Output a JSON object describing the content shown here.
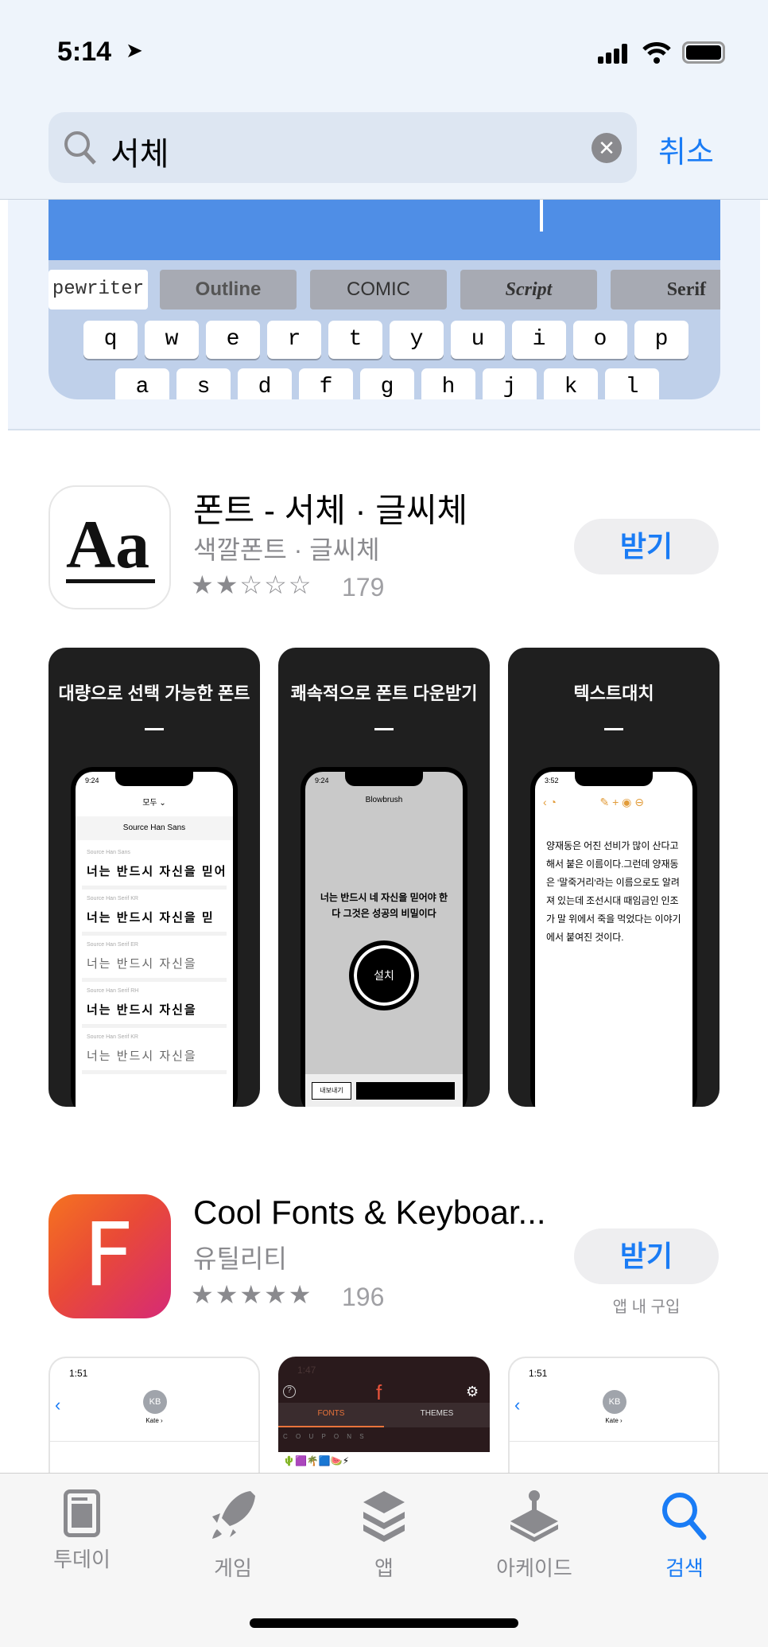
{
  "status_bar": {
    "time": "5:14"
  },
  "search": {
    "query": "서체",
    "cancel_label": "취소"
  },
  "promo": {
    "font_styles": [
      "pewriter",
      "Outline",
      "COMIC",
      "Script",
      "Serif"
    ],
    "keys_row1": [
      "q",
      "w",
      "e",
      "r",
      "t",
      "y",
      "u",
      "i",
      "o",
      "p"
    ],
    "keys_row2": [
      "a",
      "s",
      "d",
      "f",
      "g",
      "h",
      "j",
      "k",
      "l"
    ]
  },
  "apps": [
    {
      "title": "폰트 - 서체 · 글씨체",
      "subtitle": "색깔폰트 · 글씨체",
      "rating": 2,
      "rating_count": "179",
      "get_label": "받기",
      "icon_text": "Aa",
      "screenshots": [
        {
          "caption": "대량으로 선택 가능한 폰트",
          "time": "9:24",
          "header": "모두 ⌄",
          "section": "Source Han Sans",
          "rows": [
            {
              "font": "Source Han Sans",
              "sample": "너는 반드시 자신을 믿어"
            },
            {
              "font": "Source Han Serif KR",
              "sample": "너는 반드시 자신을 믿"
            },
            {
              "font": "Source Han Serif ER",
              "sample": "너는 반드시 자신을"
            },
            {
              "font": "Source Han Serif RH",
              "sample": "너는 반드시 자신을"
            },
            {
              "font": "Source Han Serif KR",
              "sample": "너는 반드시 자신을"
            }
          ]
        },
        {
          "caption": "쾌속적으로 폰트 다운받기",
          "time": "9:24",
          "header": "Blowbrush",
          "body": "너는 반드시 네 자신을 믿어야 한다 그것은 성공의 비밀이다",
          "install": "설치",
          "export": "내보내기"
        },
        {
          "caption": "텍스트대치",
          "time": "3:52",
          "body": "양재동은 어진 선비가 많이 산다고 해서 붙은 이름이다.그런데 양재동은 '말죽거리'라는 이름으로도 알려져 있는데 조선시대 때임금인 인조가 말 위에서 죽을 먹었다는 이야기에서 붙여진 것이다."
        }
      ]
    },
    {
      "title": "Cool Fonts & Keyboar...",
      "subtitle": "유틸리티",
      "rating": 5,
      "rating_count": "196",
      "get_label": "받기",
      "iap_label": "앱 내 구입",
      "icon_text": "F",
      "screenshots": [
        {
          "time": "1:51",
          "avatar": "KB",
          "name": "Kate ›"
        },
        {
          "time": "1:47",
          "tab1": "FONTS",
          "tab2": "THEMES",
          "row1": "C O U P O N S"
        },
        {
          "time": "1:51",
          "avatar": "KB",
          "name": "Kate ›"
        }
      ]
    }
  ],
  "tabbar": {
    "items": [
      {
        "label": "투데이"
      },
      {
        "label": "게임"
      },
      {
        "label": "앱"
      },
      {
        "label": "아케이드"
      },
      {
        "label": "검색"
      }
    ],
    "active": "검색"
  },
  "colors": {
    "accent": "#1a7cf5",
    "promo_blue": "#4f8ee6"
  }
}
